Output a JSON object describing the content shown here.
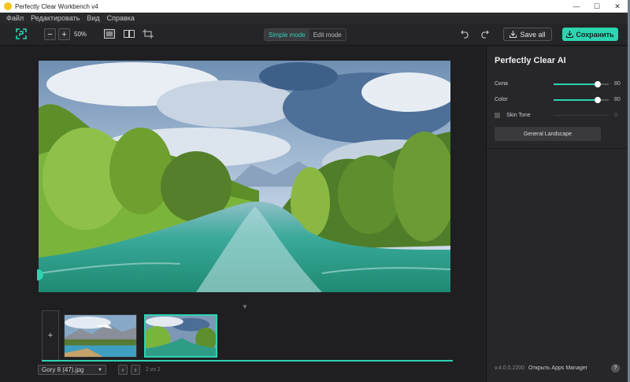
{
  "window": {
    "title": "Perfectly Clear Workbench v4",
    "minimize": "—",
    "maximize": "☐",
    "close": "✕"
  },
  "menu": [
    "Файл",
    "Редактировать",
    "Вид",
    "Справка"
  ],
  "toolbar": {
    "zoom_out": "−",
    "zoom_in": "+",
    "zoom_level": "50%",
    "mode_simple": "Simple mode",
    "mode_edit": "Edit mode",
    "active_mode": "Simple mode",
    "save_all": "Save all",
    "save": "Сохранить"
  },
  "filmstrip": {
    "add": "+",
    "file_name": "Gory 8 (47).jpg",
    "prev": "‹",
    "next": "›",
    "counter": "2 из 2",
    "selected_index": 2
  },
  "panel": {
    "title": "Perfectly Clear AI",
    "strength_label": "Сила",
    "strength_value": "80",
    "strength_level": 0.8,
    "color_label": "Color",
    "color_value": "80",
    "color_level": 0.8,
    "skin_tone_label": "Skin Tone",
    "skin_tone_value": "0",
    "skin_tone_checked": false,
    "preset": "General Landscape",
    "version": "v.4.0.0.2200",
    "apps_manager": "Открыть Apps Manager",
    "help": "?"
  },
  "colors": {
    "accent": "#2dd4b0",
    "background": "#1f1f22",
    "panel": "#27272a"
  }
}
